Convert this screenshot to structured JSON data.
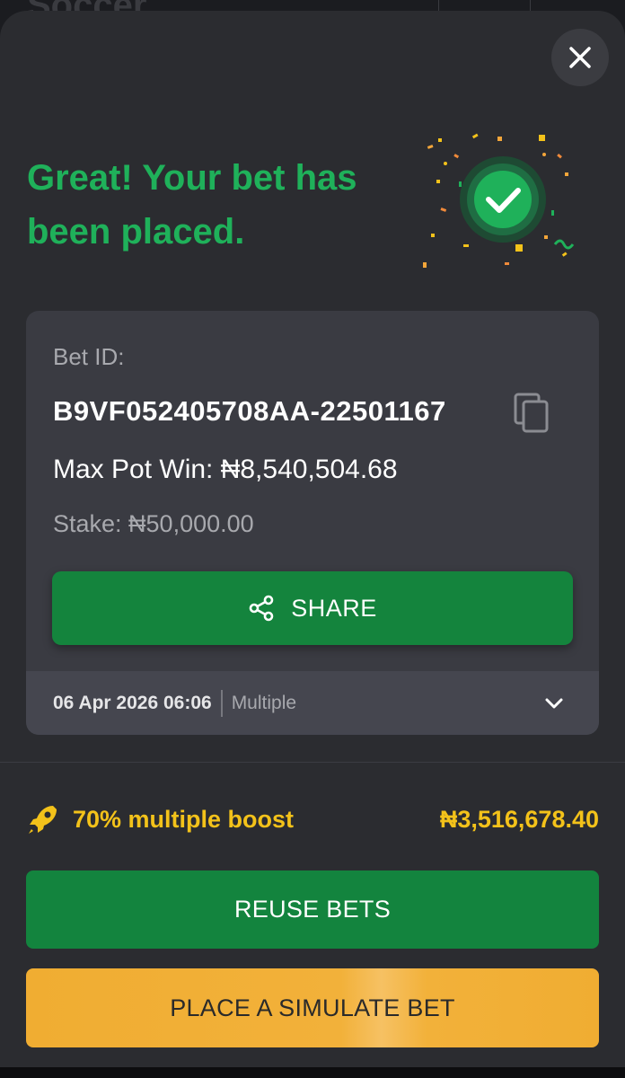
{
  "background": {
    "title": "Soccer"
  },
  "dialog": {
    "close_icon": "close-icon",
    "success_title": "Great! Your bet has been placed.",
    "success_icon": "check-circle-confetti-icon"
  },
  "bet_card": {
    "bet_id_label": "Bet ID:",
    "bet_id": "B9VF052405708AA-22501167",
    "copy_icon": "copy-icon",
    "max_pot_win": "Max Pot Win: ₦8,540,504.68",
    "stake": "Stake: ₦50,000.00",
    "share_label": "SHARE",
    "share_icon": "share-icon",
    "date": "06 Apr 2026 06:06",
    "bet_type": "Multiple",
    "expand_icon": "chevron-down-icon"
  },
  "boost": {
    "icon": "rocket-icon",
    "label": "70% multiple boost",
    "amount": "₦3,516,678.40"
  },
  "actions": {
    "reuse_label": "REUSE BETS",
    "simulate_label": "PLACE A SIMULATE BET"
  },
  "colors": {
    "success_green": "#1fb15a",
    "button_green": "#14843d",
    "boost_yellow": "#f3c21a",
    "simulate_orange": "#f0ad32",
    "sheet_bg": "#2b2c30",
    "card_bg": "#3a3b42"
  }
}
